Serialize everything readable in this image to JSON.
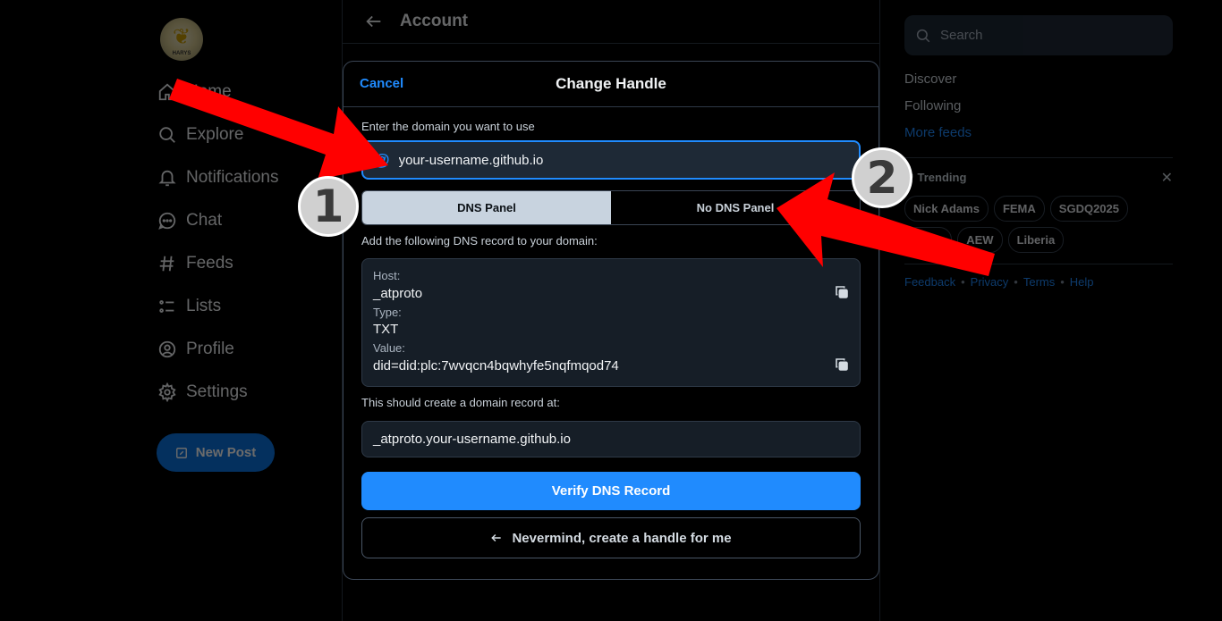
{
  "left_nav": {
    "avatar_text": "HARYS",
    "items": [
      {
        "label": "Home",
        "icon": "home-icon"
      },
      {
        "label": "Explore",
        "icon": "search-icon"
      },
      {
        "label": "Notifications",
        "icon": "bell-icon"
      },
      {
        "label": "Chat",
        "icon": "chat-icon"
      },
      {
        "label": "Feeds",
        "icon": "hash-icon"
      },
      {
        "label": "Lists",
        "icon": "list-icon"
      },
      {
        "label": "Profile",
        "icon": "user-circle-icon"
      },
      {
        "label": "Settings",
        "icon": "gear-icon"
      }
    ],
    "new_post_label": "New Post"
  },
  "center": {
    "header_title": "Account"
  },
  "right_col": {
    "search_placeholder": "Search",
    "feeds": [
      "Discover",
      "Following"
    ],
    "more_feeds": "More feeds",
    "trending_title": "Trending",
    "trending_chips": [
      "Nick Adams",
      "FEMA",
      "SGDQ2025",
      "Duffy",
      "AEW",
      "Liberia"
    ],
    "footer_links": [
      "Feedback",
      "Privacy",
      "Terms",
      "Help"
    ]
  },
  "modal": {
    "cancel_label": "Cancel",
    "title": "Change Handle",
    "domain_label": "Enter the domain you want to use",
    "handle_value": "your-username.github.io",
    "tabs": [
      {
        "label": "DNS Panel",
        "active": true
      },
      {
        "label": "No DNS Panel",
        "active": false
      }
    ],
    "dns_instructions": "Add the following DNS record to your domain:",
    "host_label": "Host:",
    "host_value": "_atproto",
    "type_label": "Type:",
    "type_value": "TXT",
    "value_label": "Value:",
    "value_value": "did=did:plc:7wvqcn4bqwhyfe5nqfmqod74",
    "record_label": "This should create a domain record at:",
    "record_value": "_atproto.your-username.github.io",
    "verify_label": "Verify DNS Record",
    "nevermind_label": "Nevermind, create a handle for me"
  },
  "annotations": {
    "badge_1": "1",
    "badge_2": "2",
    "arrow_color": "#ff0000"
  },
  "colors": {
    "accent": "#208bfe",
    "background": "#000000",
    "surface": "#161e27",
    "border": "#2e3947",
    "active_tab": "#c8d3df"
  }
}
